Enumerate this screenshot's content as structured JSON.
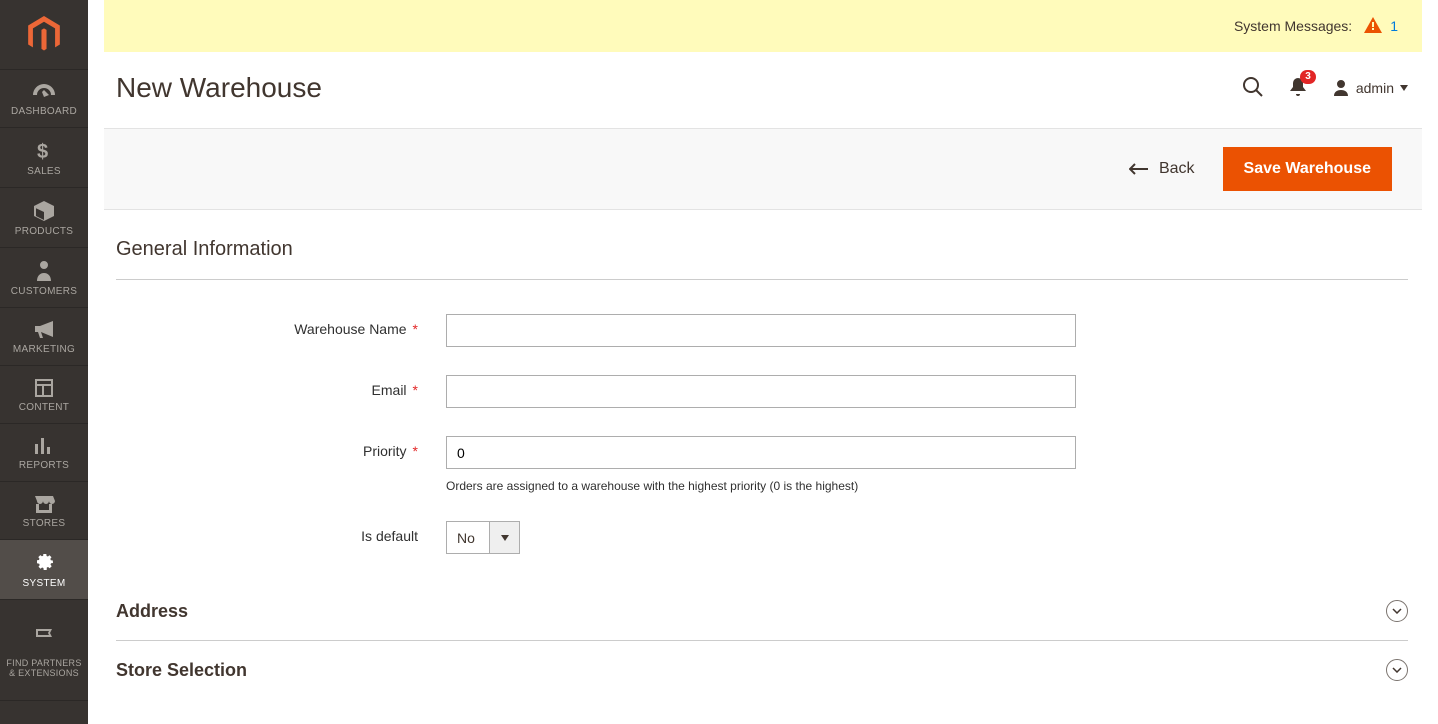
{
  "system_messages": {
    "label": "System Messages:",
    "count": "1"
  },
  "header": {
    "title": "New Warehouse",
    "user": "admin",
    "notification_count": "3"
  },
  "actions": {
    "back": "Back",
    "save": "Save Warehouse"
  },
  "sidebar": {
    "items": [
      {
        "label": "DASHBOARD"
      },
      {
        "label": "SALES"
      },
      {
        "label": "PRODUCTS"
      },
      {
        "label": "CUSTOMERS"
      },
      {
        "label": "MARKETING"
      },
      {
        "label": "CONTENT"
      },
      {
        "label": "REPORTS"
      },
      {
        "label": "STORES"
      },
      {
        "label": "SYSTEM"
      },
      {
        "label": "FIND PARTNERS\n& EXTENSIONS"
      }
    ]
  },
  "sections": {
    "general": {
      "title": "General Information",
      "fields": {
        "name": {
          "label": "Warehouse Name",
          "value": ""
        },
        "email": {
          "label": "Email",
          "value": ""
        },
        "priority": {
          "label": "Priority",
          "value": "0",
          "note": "Orders are assigned to a warehouse with the highest priority (0 is the highest)"
        },
        "is_default": {
          "label": "Is default",
          "value": "No"
        }
      }
    },
    "address": {
      "title": "Address"
    },
    "store_selection": {
      "title": "Store Selection"
    }
  }
}
